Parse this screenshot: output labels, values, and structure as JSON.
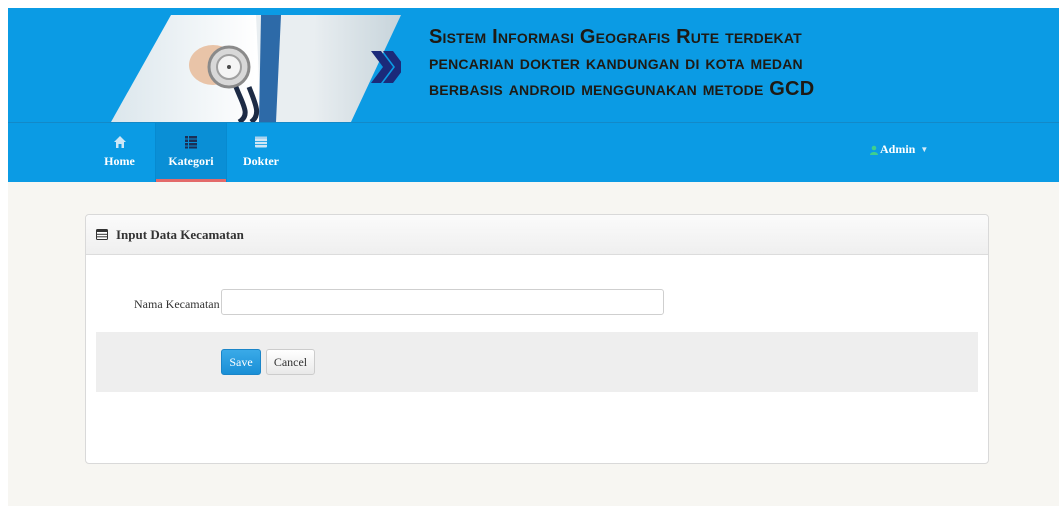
{
  "header": {
    "title_lines": [
      "Sistem Informasi Geografis  Rute terdekat",
      "pencarian dokter kandungan di kota medan",
      "berbasis android menggunakan metode GCD"
    ]
  },
  "nav": {
    "items": [
      {
        "label": "Home",
        "icon": "home-icon",
        "active": false
      },
      {
        "label": "Kategori",
        "icon": "list-icon",
        "active": true
      },
      {
        "label": "Dokter",
        "icon": "table-icon",
        "active": false
      }
    ],
    "user": {
      "label": "Admin",
      "icon": "user-icon"
    }
  },
  "panel": {
    "title": "Input Data Kecamatan",
    "title_icon": "table-icon",
    "form": {
      "field_label": "Nama Kecamatan",
      "field_value": "",
      "save_label": "Save",
      "cancel_label": "Cancel"
    }
  },
  "colors": {
    "header_bg": "#0b9be4",
    "active_underline": "#e36a6a",
    "primary_button": "#1a8fd6",
    "page_bg": "#f7f6f2"
  }
}
